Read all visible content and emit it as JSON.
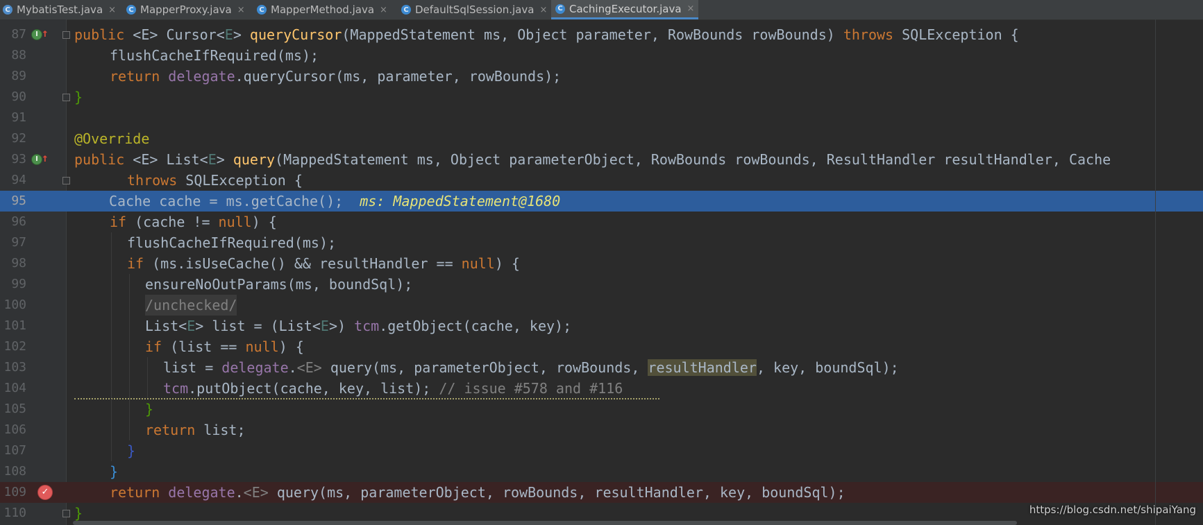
{
  "tabs": [
    {
      "label": "MybatisTest.java",
      "icon": "test-class-icon"
    },
    {
      "label": "MapperProxy.java",
      "icon": "class-icon"
    },
    {
      "label": "MapperMethod.java",
      "icon": "class-icon"
    },
    {
      "label": "DefaultSqlSession.java",
      "icon": "class-icon"
    },
    {
      "label": "CachingExecutor.java",
      "icon": "class-icon",
      "active": true
    }
  ],
  "close_glyph": "×",
  "line_numbers": [
    "87",
    "88",
    "89",
    "90",
    "91",
    "92",
    "93",
    "94",
    "95",
    "96",
    "97",
    "98",
    "99",
    "100",
    "101",
    "102",
    "103",
    "104",
    "105",
    "106",
    "107",
    "108",
    "109",
    "110"
  ],
  "code": {
    "l87": {
      "kw1": "public",
      "gen": "<E>",
      "t1": "Cursor<",
      "e": "E",
      "t2": "> ",
      "fn": "queryCursor",
      "rest": "(MappedStatement ms, Object parameter, RowBounds rowBounds) ",
      "kw2": "throws",
      "t3": " SQLException {"
    },
    "l88": {
      "text": "flushCacheIfRequired(ms);"
    },
    "l89": {
      "kw": "return",
      "fld": "delegate",
      "rest": ".queryCursor(ms, parameter, rowBounds);"
    },
    "l90": {
      "text": "}"
    },
    "l92": {
      "text": "@Override"
    },
    "l93": {
      "kw1": "public",
      "gen": "<E>",
      "t1": "List<",
      "e": "E",
      "t2": "> ",
      "fn": "query",
      "rest": "(MappedStatement ms, Object parameterObject, RowBounds rowBounds, ResultHandler resultHandler, Cache"
    },
    "l94": {
      "kw": "throws",
      "rest": " SQLException {"
    },
    "l95": {
      "code": "Cache cache = ms.getCache();",
      "hint": "ms: MappedStatement@1680"
    },
    "l96": {
      "kw": "if",
      "rest": " (cache != ",
      "kw2": "null",
      "rest2": ") {"
    },
    "l97": {
      "text": "flushCacheIfRequired(ms);"
    },
    "l98": {
      "kw": "if",
      "rest": " (ms.isUseCache() && resultHandler == ",
      "kw2": "null",
      "rest2": ") {"
    },
    "l99": {
      "text": "ensureNoOutParams(ms, boundSql);"
    },
    "l100": {
      "text": "/unchecked/"
    },
    "l101": {
      "t1": "List<",
      "e": "E",
      "t2": "> list = (List<",
      "e2": "E",
      "t3": ">) ",
      "fld": "tcm",
      "rest": ".getObject(cache, key);"
    },
    "l102": {
      "kw": "if",
      "rest": " (list == ",
      "kw2": "null",
      "rest2": ") {"
    },
    "l103": {
      "t1": "list = ",
      "fld": "delegate",
      "t2": ".",
      "gen": "<E>",
      "t3": " query(ms, parameterObject, rowBounds, ",
      "hl": "resultHandler",
      "t4": ", key, boundSql);"
    },
    "l104": {
      "fld": "tcm",
      "rest": ".putObject(cache, key, list); ",
      "cm": "// issue #578 and #116"
    },
    "l105": {
      "text": "}"
    },
    "l106": {
      "kw": "return",
      "rest": " list;"
    },
    "l107": {
      "text": "}"
    },
    "l108": {
      "text": "}"
    },
    "l109": {
      "kw": "return",
      "fld": "delegate",
      "t1": ".",
      "gen": "<E>",
      "rest": " query(ms, parameterObject, rowBounds, resultHandler, key, boundSql);"
    },
    "l110": {
      "text": "}"
    }
  },
  "watermark": "https://blog.csdn.net/shipaiYang",
  "colors": {
    "execution_line": "#2d5d9c",
    "breakpoint_line": "#3a2323",
    "keyword": "#cc7832",
    "method": "#ffc66d",
    "field": "#9876aa"
  }
}
